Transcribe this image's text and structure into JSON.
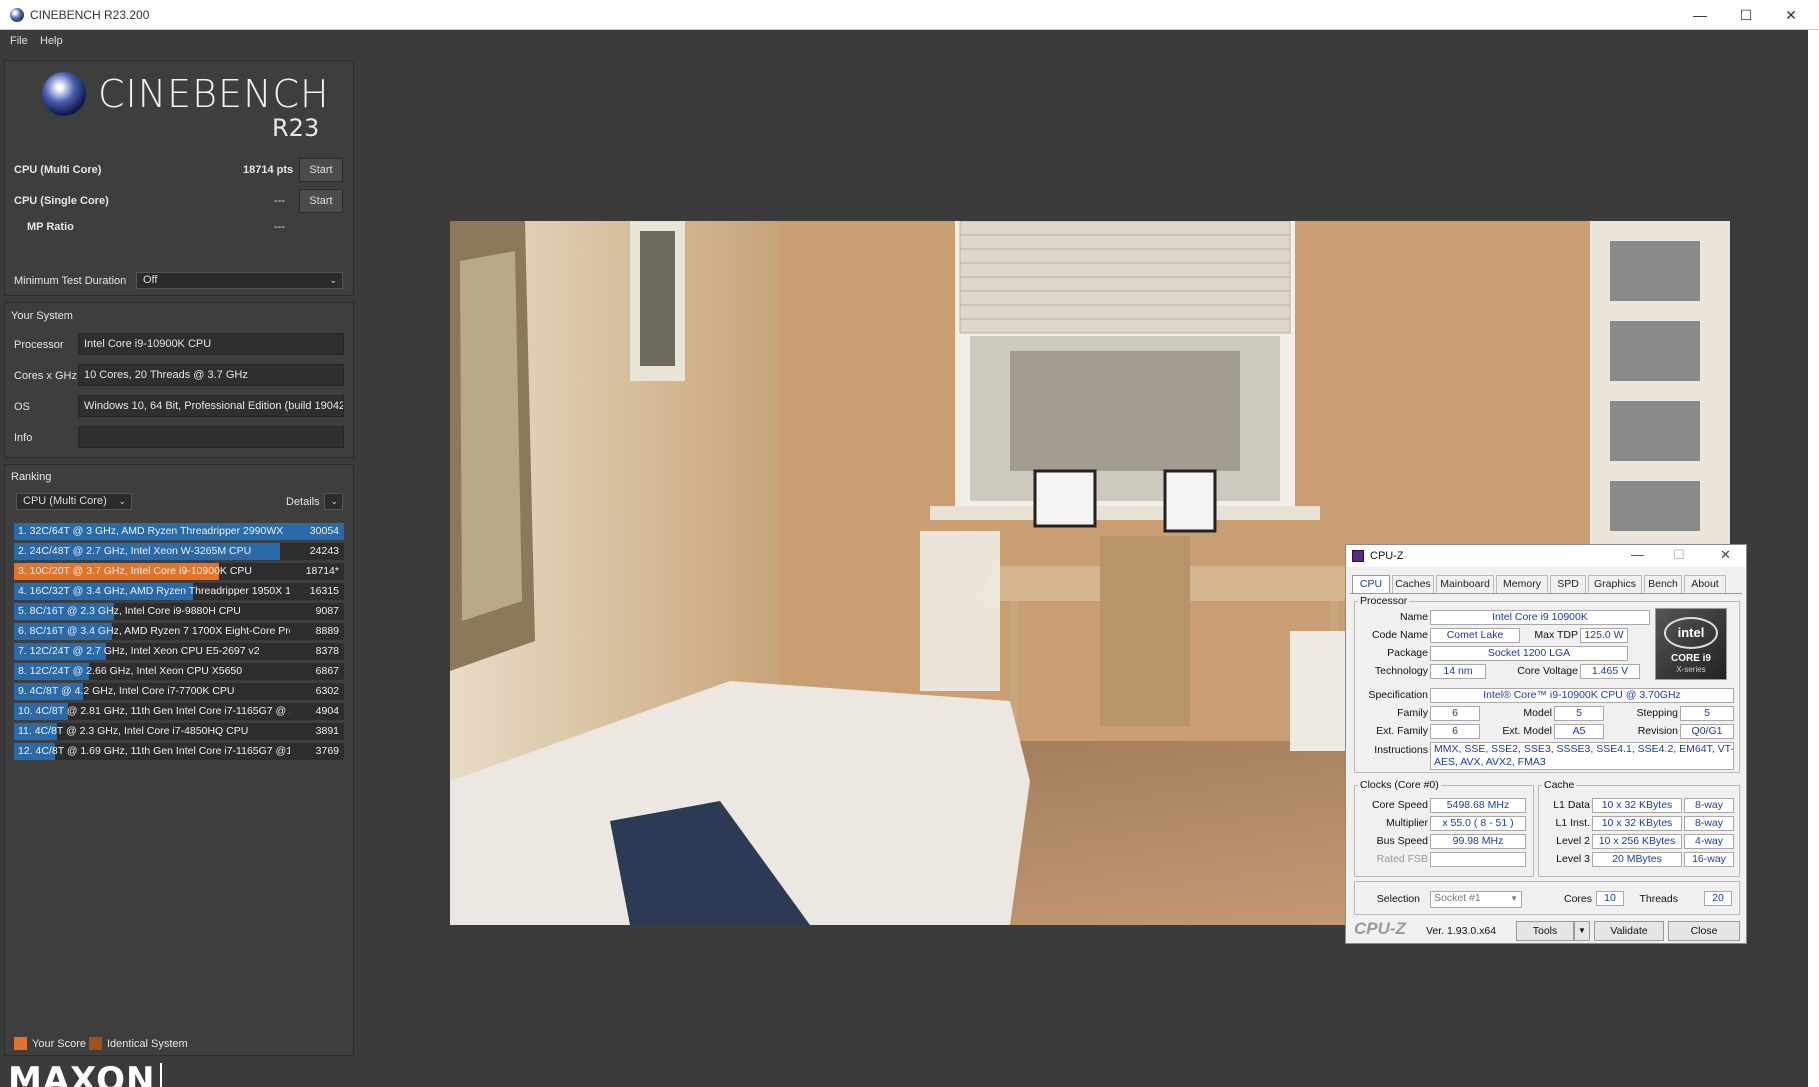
{
  "window": {
    "title": "CINEBENCH R23.200",
    "minimize": "—",
    "maximize": "☐",
    "close": "✕"
  },
  "menu": {
    "file": "File",
    "help": "Help"
  },
  "logo": {
    "name": "CINEBENCH",
    "version": "R23"
  },
  "tests": {
    "multi_label": "CPU (Multi Core)",
    "multi_value": "18714 pts",
    "multi_start": "Start",
    "single_label": "CPU (Single Core)",
    "single_value": "---",
    "single_start": "Start",
    "mp_label": "MP Ratio",
    "mp_value": "---"
  },
  "duration": {
    "label": "Minimum Test Duration",
    "value": "Off"
  },
  "system": {
    "section": "Your System",
    "processor_label": "Processor",
    "processor": "Intel Core i9-10900K CPU",
    "cores_label": "Cores x GHz",
    "cores": "10 Cores, 20 Threads @ 3.7 GHz",
    "os_label": "OS",
    "os": "Windows 10, 64 Bit, Professional Edition (build 19042",
    "info_label": "Info",
    "info": ""
  },
  "ranking": {
    "section": "Ranking",
    "dropdown": "CPU (Multi Core)",
    "details": "Details",
    "max": 30054,
    "rows": [
      {
        "text": "1. 32C/64T @ 3 GHz, AMD Ryzen Threadripper 2990WX",
        "score": "30054",
        "value": 30054,
        "current": false
      },
      {
        "text": "2. 24C/48T @ 2.7 GHz, Intel Xeon W-3265M CPU",
        "score": "24243",
        "value": 24243,
        "current": false
      },
      {
        "text": "3. 10C/20T @ 3.7 GHz, Intel Core i9-10900K CPU",
        "score": "18714*",
        "value": 18714,
        "current": true
      },
      {
        "text": "4. 16C/32T @ 3.4 GHz, AMD Ryzen Threadripper 1950X 1",
        "score": "16315",
        "value": 16315,
        "current": false
      },
      {
        "text": "5. 8C/16T @ 2.3 GHz, Intel Core i9-9880H CPU",
        "score": "9087",
        "value": 9087,
        "current": false
      },
      {
        "text": "6. 8C/16T @ 3.4 GHz, AMD Ryzen 7 1700X Eight-Core Pro",
        "score": "8889",
        "value": 8889,
        "current": false
      },
      {
        "text": "7. 12C/24T @ 2.7 GHz, Intel Xeon CPU E5-2697 v2",
        "score": "8378",
        "value": 8378,
        "current": false
      },
      {
        "text": "8. 12C/24T @ 2.66 GHz, Intel Xeon CPU X5650",
        "score": "6867",
        "value": 6867,
        "current": false
      },
      {
        "text": "9. 4C/8T @ 4.2 GHz, Intel Core i7-7700K CPU",
        "score": "6302",
        "value": 6302,
        "current": false
      },
      {
        "text": "10. 4C/8T @ 2.81 GHz, 11th Gen Intel Core i7-1165G7 @ 2",
        "score": "4904",
        "value": 4904,
        "current": false
      },
      {
        "text": "11. 4C/8T @ 2.3 GHz, Intel Core i7-4850HQ CPU",
        "score": "3891",
        "value": 3891,
        "current": false
      },
      {
        "text": "12. 4C/8T @ 1.69 GHz, 11th Gen Intel Core i7-1165G7 @1",
        "score": "3769",
        "value": 3769,
        "current": false
      }
    ]
  },
  "legend": {
    "your_score": "Your Score",
    "identical": "Identical System",
    "your_color": "#e0742a",
    "identical_color": "#a0501a"
  },
  "footer": {
    "brand": "MAXON"
  },
  "cpuz": {
    "title": "CPU-Z",
    "tabs": [
      "CPU",
      "Caches",
      "Mainboard",
      "Memory",
      "SPD",
      "Graphics",
      "Bench",
      "About"
    ],
    "processor_group": "Processor",
    "name_label": "Name",
    "name": "Intel Core i9 10900K",
    "codename_label": "Code Name",
    "codename": "Comet Lake",
    "maxtdp_label": "Max TDP",
    "maxtdp": "125.0 W",
    "package_label": "Package",
    "package": "Socket 1200 LGA",
    "tech_label": "Technology",
    "tech": "14 nm",
    "voltage_label": "Core Voltage",
    "voltage": "1.465 V",
    "spec_label": "Specification",
    "spec": "Intel® Core™ i9-10900K CPU @ 3.70GHz",
    "family_label": "Family",
    "family": "6",
    "model_label": "Model",
    "model": "5",
    "stepping_label": "Stepping",
    "stepping": "5",
    "extfamily_label": "Ext. Family",
    "extfamily": "6",
    "extmodel_label": "Ext. Model",
    "extmodel": "A5",
    "revision_label": "Revision",
    "revision": "Q0/G1",
    "instr_label": "Instructions",
    "instr1": "MMX, SSE, SSE2, SSE3, SSSE3, SSE4.1, SSE4.2, EM64T, VT-x,",
    "instr2": "AES, AVX, AVX2, FMA3",
    "intel_badge": {
      "brand": "intel",
      "line1": "CORE i9",
      "line2": "X-series"
    },
    "clocks_group": "Clocks (Core #0)",
    "corespeed_label": "Core Speed",
    "corespeed": "5498.68 MHz",
    "mult_label": "Multiplier",
    "mult": "x 55.0 ( 8 - 51 )",
    "bus_label": "Bus Speed",
    "bus": "99.98 MHz",
    "fsb_label": "Rated FSB",
    "fsb": "",
    "cache_group": "Cache",
    "l1d_label": "L1 Data",
    "l1d": "10 x 32 KBytes",
    "l1d_way": "8-way",
    "l1i_label": "L1 Inst.",
    "l1i": "10 x 32 KBytes",
    "l1i_way": "8-way",
    "l2_label": "Level 2",
    "l2": "10 x 256 KBytes",
    "l2_way": "4-way",
    "l3_label": "Level 3",
    "l3": "20 MBytes",
    "l3_way": "16-way",
    "selection_label": "Selection",
    "selection": "Socket #1",
    "cores_label": "Cores",
    "cores": "10",
    "threads_label": "Threads",
    "threads": "20",
    "brand": "CPU-Z",
    "version": "Ver. 1.93.0.x64",
    "tools": "Tools",
    "validate": "Validate",
    "close": "Close"
  }
}
